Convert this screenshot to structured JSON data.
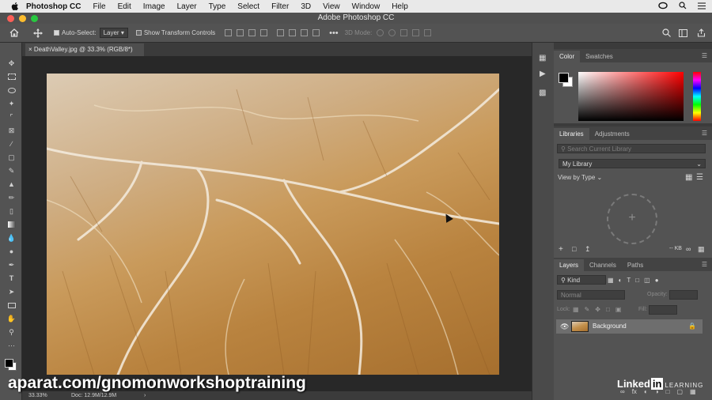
{
  "menubar": {
    "app_name": "Photoshop CC",
    "items": [
      "File",
      "Edit",
      "Image",
      "Layer",
      "Type",
      "Select",
      "Filter",
      "3D",
      "View",
      "Window",
      "Help"
    ]
  },
  "window": {
    "title": "Adobe Photoshop CC"
  },
  "options_bar": {
    "auto_select_label": "Auto-Select:",
    "auto_select_value": "Layer",
    "transform_label": "Show Transform Controls",
    "mode_label": "3D Mode:"
  },
  "document": {
    "tab_label": "DeathValley.jpg @ 33.3% (RGB/8*)"
  },
  "status": {
    "zoom": "33.33%",
    "doc_info": "Doc: 12.9M/12.9M"
  },
  "color_panel": {
    "tabs": [
      "Color",
      "Swatches"
    ]
  },
  "libraries_panel": {
    "tabs": [
      "Libraries",
      "Adjustments"
    ],
    "search_placeholder": "Search Current Library",
    "library_name": "My Library",
    "view_by": "View by Type",
    "size": "-- KB"
  },
  "layers_panel": {
    "tabs": [
      "Layers",
      "Channels",
      "Paths"
    ],
    "kind": "Kind",
    "blend_mode": "Normal",
    "opacity_label": "Opacity:",
    "lock_label": "Lock:",
    "fill_label": "Fill:",
    "layer_name": "Background"
  },
  "overlay": {
    "watermark": "aparat.com/gnomonworkshoptraining",
    "brand": "Linked",
    "brand_in": "in",
    "learning": "LEARNING"
  },
  "colors": {
    "menubar_bg": "#e9e9e9",
    "panel_bg": "#535353",
    "canvas_bg": "#282828"
  }
}
